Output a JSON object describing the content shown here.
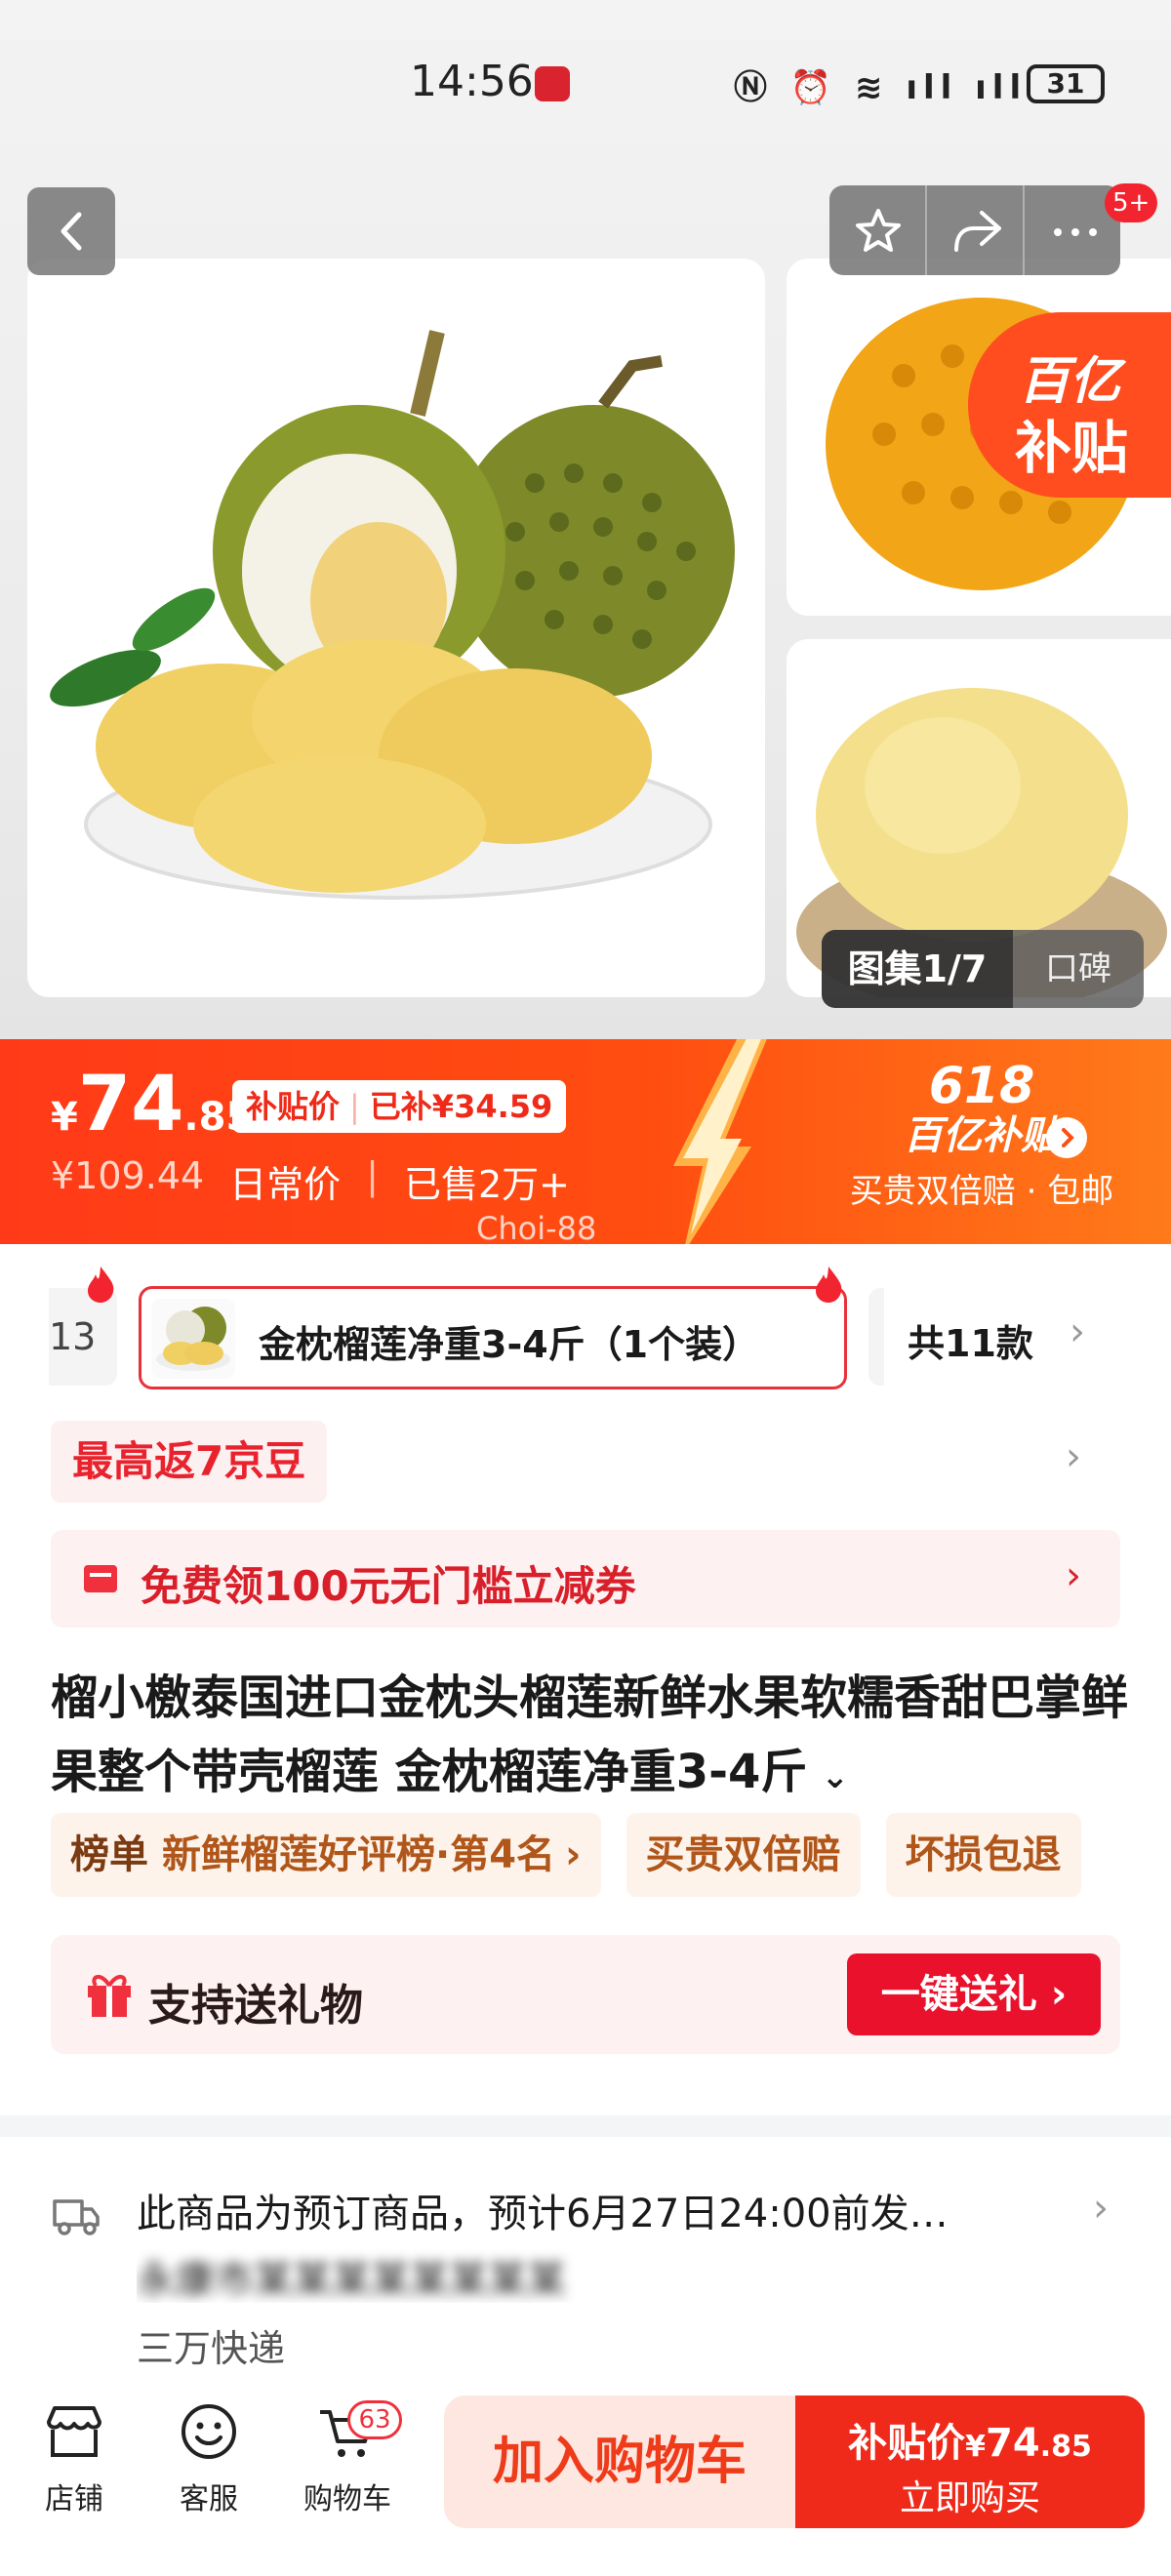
{
  "status_bar": {
    "time": "14:56",
    "battery": "31"
  },
  "header": {
    "cart_badge": "5+"
  },
  "gallery": {
    "subsidy_line1": "百亿",
    "subsidy_line2": "补贴",
    "gallery_label": "图集1/7",
    "reviews_label": "口碑"
  },
  "price": {
    "yen": "¥",
    "integer": "74",
    "decimal": ".85",
    "subsidy_label": "补贴价",
    "subsidy_amount": "已补¥34.59",
    "original": "¥109.44",
    "daily_label": "日常价",
    "sold": "已售2万+",
    "promo_number": "618",
    "promo_brand": "百亿补贴",
    "promo_sub": "买贵双倍赔 · 包邮",
    "watermark": "Choi-88"
  },
  "sku": {
    "prev_partial": "13",
    "selected": "金枕榴莲净重3-4斤（1个装）",
    "count": "共11款"
  },
  "beans": "最高返7京豆",
  "coupon": "免费领100元无门槛立减券",
  "title": "榴小檄泰国进口金枕头榴莲新鲜水果软糯香甜巴掌鲜果整个带壳榴莲 金枕榴莲净重3-4斤",
  "tags": {
    "rank_lead": "榜单",
    "rank_text": "新鲜榴莲好评榜·第4名",
    "double_pay": "买贵双倍赔",
    "damage_return": "坏损包退"
  },
  "gift": {
    "label": "支持送礼物",
    "button": "一键送礼"
  },
  "shipping": {
    "line1": "此商品为预订商品，预计6月27日24:00前发…",
    "line2": "永康市某某某某某某某某",
    "line3": "三万快递"
  },
  "bottom": {
    "store": "店铺",
    "service": "客服",
    "cart": "购物车",
    "cart_count": "63",
    "add_to_cart": "加入购物车",
    "buy_price_label": "补贴价",
    "buy_price_yen": "¥",
    "buy_price_int": "74",
    "buy_price_dec": ".85",
    "buy_now": "立即购买"
  },
  "colors": {
    "accent": "#ef2a1a",
    "banner_start": "#ff3a18",
    "banner_end": "#ff7a1a",
    "tag_text": "#b0561a"
  }
}
